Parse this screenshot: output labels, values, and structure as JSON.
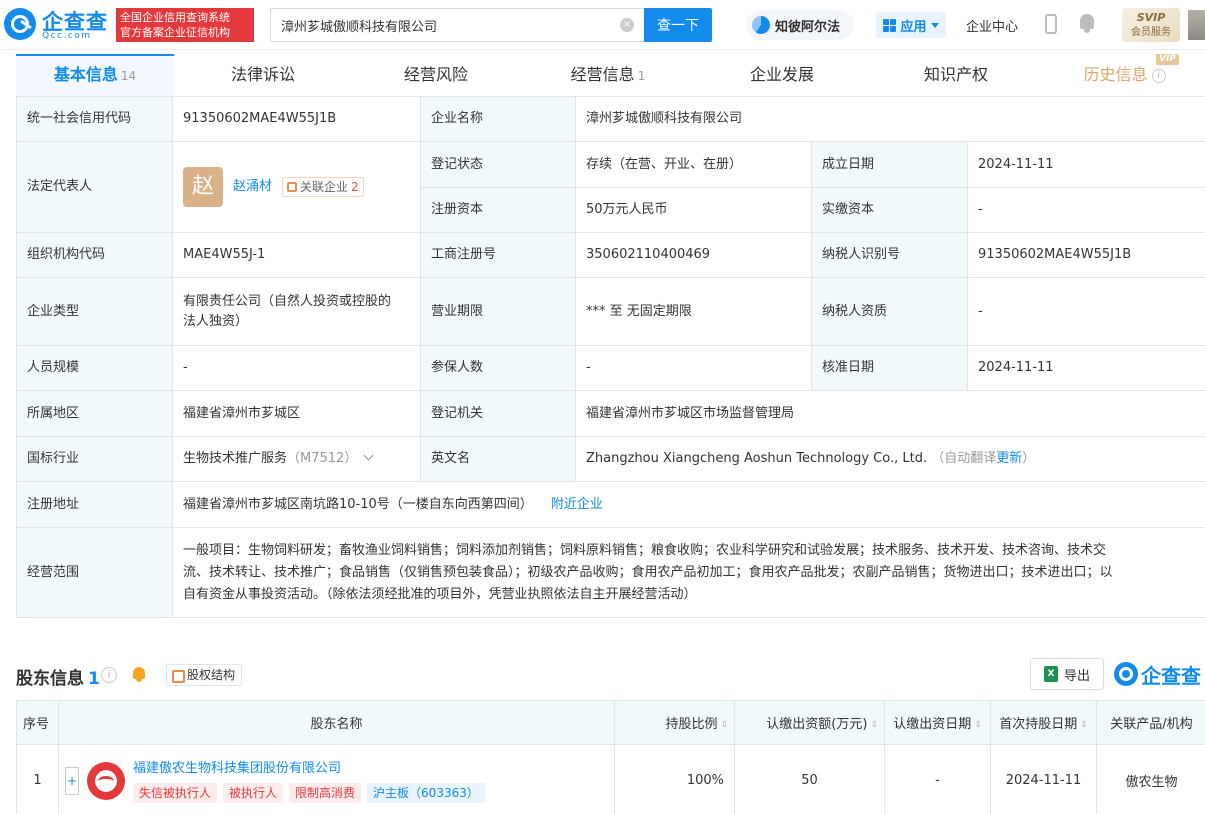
{
  "header": {
    "logo_text": "企查查",
    "logo_sub": "Qcc.com",
    "gov_badge_line1": "全国企业信用查询系统",
    "gov_badge_line2": "官方备案企业征信机构",
    "search_value": "漳州芗城傲顺科技有限公司",
    "search_clear_label": "×",
    "search_button": "查一下",
    "zhibi_label": "知彼阿尔法",
    "apps_label": "应用",
    "enterprise_center": "企业中心",
    "svip_line1": "SVIP",
    "svip_line2": "会员服务"
  },
  "tabs": [
    {
      "label": "基本信息",
      "count": "14",
      "active": true
    },
    {
      "label": "法律诉讼",
      "count": ""
    },
    {
      "label": "经营风险",
      "count": ""
    },
    {
      "label": "经营信息",
      "count": "1"
    },
    {
      "label": "企业发展",
      "count": ""
    },
    {
      "label": "知识产权",
      "count": ""
    },
    {
      "label": "历史信息",
      "count": "",
      "vip_tag": "VIP",
      "help_icon": "i"
    }
  ],
  "info": {
    "credit_code_label": "统一社会信用代码",
    "credit_code": "91350602MAE4W55J1B",
    "company_name_label": "企业名称",
    "company_name": "漳州芗城傲顺科技有限公司",
    "legal_rep_label": "法定代表人",
    "legal_rep_avatar": "赵",
    "legal_rep_name": "赵涌材",
    "legal_rep_related_label": "关联企业",
    "legal_rep_related_count": "2",
    "status_label": "登记状态",
    "status": "存续（在营、开业、在册）",
    "founded_label": "成立日期",
    "founded": "2024-11-11",
    "reg_capital_label": "注册资本",
    "reg_capital": "50万元人民币",
    "paid_capital_label": "实缴资本",
    "paid_capital": "-",
    "org_code_label": "组织机构代码",
    "org_code": "MAE4W55J-1",
    "biz_reg_no_label": "工商注册号",
    "biz_reg_no": "350602110400469",
    "taxpayer_id_label": "纳税人识别号",
    "taxpayer_id": "91350602MAE4W55J1B",
    "ent_type_label": "企业类型",
    "ent_type_line1": "有限责任公司（自然人投资或控股的",
    "ent_type_line2": "法人独资）",
    "biz_term_label": "营业期限",
    "biz_term": "*** 至 无固定期限",
    "taxpayer_qual_label": "纳税人资质",
    "taxpayer_qual": "-",
    "staff_size_label": "人员规模",
    "staff_size": "-",
    "insured_label": "参保人数",
    "insured": "-",
    "approved_label": "核准日期",
    "approved": "2024-11-11",
    "region_label": "所属地区",
    "region": "福建省漳州市芗城区",
    "authority_label": "登记机关",
    "authority": "福建省漳州市芗城区市场监督管理局",
    "industry_label": "国标行业",
    "industry": "生物技术推广服务",
    "industry_code": "（M7512）",
    "english_name_label": "英文名",
    "english_name": "Zhangzhou Xiangcheng Aoshun Technology Co., Ltd.",
    "english_note": "（自动翻译",
    "english_update": "更新",
    "english_note_end": "）",
    "address_label": "注册地址",
    "address": "福建省漳州市芗城区南坑路10-10号（一楼自东向西第四间）",
    "nearby": "附近企业",
    "scope_label": "经营范围",
    "scope_line1": "一般项目：生物饲料研发；畜牧渔业饲料销售；饲料添加剂销售；饲料原料销售；粮食收购；农业科学研究和试验发展；技术服务、技术开发、技术咨询、技术交",
    "scope_line2": "流、技术转让、技术推广；食品销售（仅销售预包装食品）；初级农产品收购；食用农产品初加工；食用农产品批发；农副产品销售；货物进出口；技术进出口；以",
    "scope_line3": "自有资金从事投资活动。（除依法须经批准的项目外，凭营业执照依法自主开展经营活动）"
  },
  "shareholders": {
    "title": "股东信息",
    "count": "1",
    "help_icon": "i",
    "equity_button": "股权结构",
    "export_button": "导出",
    "export_icon_text": "X",
    "brand": "企查查",
    "columns": [
      "序号",
      "股东名称",
      "持股比例",
      "认缴出资额(万元)",
      "认缴出资日期",
      "首次持股日期",
      "关联产品/机构"
    ],
    "sort_symbol": "⇕",
    "rows": [
      {
        "index": "1",
        "expand": "+",
        "name": "福建傲农生物科技集团股份有限公司",
        "tags": [
          "失信被执行人",
          "被执行人",
          "限制高消费"
        ],
        "board_tag": "沪主板（603363）",
        "ratio": "100%",
        "subscribed": "50",
        "subscribe_date": "-",
        "first_hold_date": "2024-11-11",
        "related": "傲农生物"
      }
    ]
  }
}
